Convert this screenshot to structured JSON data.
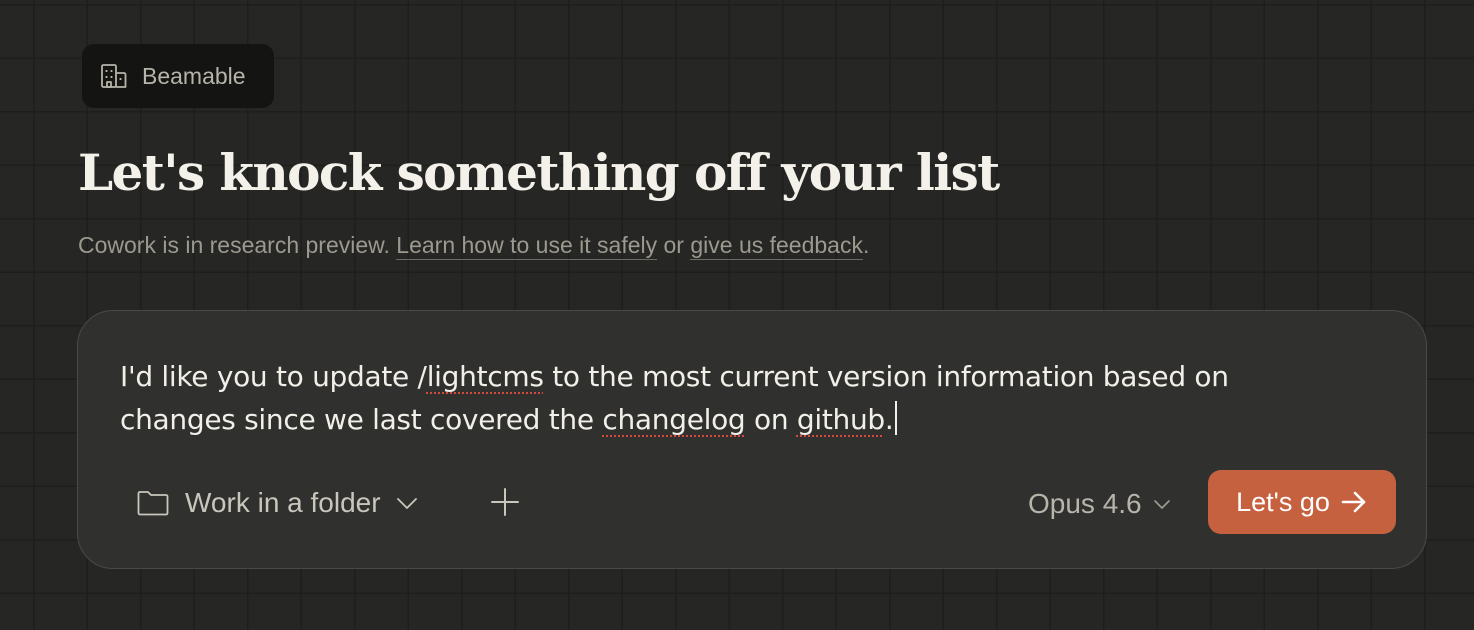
{
  "workspace": {
    "name": "Beamable",
    "icon": "building-icon"
  },
  "headline": "Let's knock something off your list",
  "subline": {
    "prefix": "Cowork is in research preview. ",
    "learn_link": "Learn how to use it safely",
    "middle": " or ",
    "feedback_link": "give us feedback",
    "suffix": "."
  },
  "composer": {
    "prompt": {
      "part1": "I'd like you to update /",
      "word1": "lightcms",
      "part2": " to the most current version information based on changes since we last covered the ",
      "word2": "changelog",
      "part3": " on ",
      "word3": "github",
      "part4": "."
    },
    "folder_button": {
      "label": "Work in a folder",
      "icon": "folder-icon"
    },
    "add_icon": "plus-icon",
    "model": {
      "selected": "Opus 4.6"
    },
    "submit_label": "Let's go",
    "submit_icon": "arrow-right-icon"
  },
  "colors": {
    "background": "#262624",
    "composer": "#30302e",
    "accent": "#c6613f",
    "spellcheck": "#d44a3e"
  }
}
